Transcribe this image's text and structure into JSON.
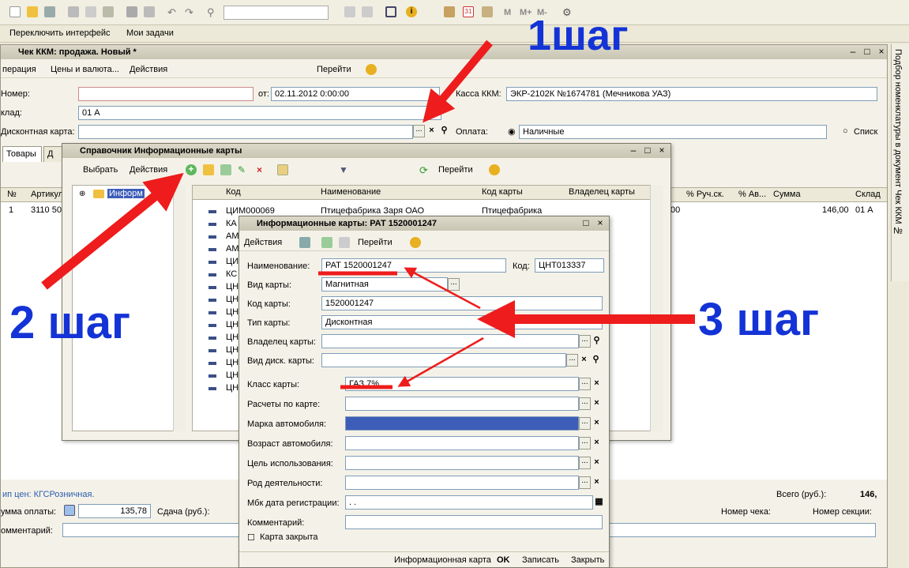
{
  "top": {
    "switch_iface": "Переключить интерфейс",
    "my_tasks": "Мои задачи",
    "letters_m": "M",
    "letters_mplus": "M+",
    "letters_mminus": "M-"
  },
  "main": {
    "title": "Чек ККМ: продажа. Новый *",
    "menu": {
      "operation": "перация",
      "prices": "Цены и валюта...",
      "actions": "Действия",
      "goto": "Перейти"
    },
    "fields": {
      "number_label": "Номер:",
      "date_label": "от:",
      "date_value": "02.11.2012  0:00:00",
      "kassa_label": "Касса ККМ:",
      "kassa_value": "ЭКР-2102К №1674781 (Мечникова УАЗ)",
      "warehouse_label": "клад:",
      "warehouse_value": "01 А",
      "card_label": "Дисконтная карта:",
      "payment_label": "Оплата:",
      "payment_value": "Наличные",
      "list_label": "Списк"
    },
    "tabs": {
      "goods": "Товары",
      "d": "Д"
    },
    "columns": {
      "num": "№",
      "article": "Артикул",
      "percent_manual": "% Руч.ск.",
      "percent_auto": "% Ав...",
      "sum": "Сумма",
      "warehouse": "Склад"
    },
    "row": {
      "num": "1",
      "article": "3110 50",
      "v1": "00",
      "sum": "146,00",
      "wh": "01 А"
    },
    "footer": {
      "price_type": "ип цен: КГСРозничная.",
      "total_label": "Всего (руб.):",
      "total_value": "146,",
      "pay_sum_label": "умма оплаты:",
      "pay_sum_value": "135,78",
      "change_label": "Сдача (руб.):",
      "check_no_label": "Номер чека:",
      "section_label": "Номер секции:",
      "comment_label": "омментарий:"
    }
  },
  "right_panel": {
    "text": "Подбор номенклатуры в документ Чек ККМ №"
  },
  "ref_window": {
    "title": "Справочник Информационные карты",
    "toolbar": {
      "select": "Выбрать",
      "actions": "Действия",
      "goto": "Перейти"
    },
    "tree_root": "Информ",
    "columns": {
      "code": "Код",
      "name": "Наименование",
      "card_code": "Код карты",
      "owner": "Владелец карты"
    },
    "first_row": {
      "code": "ЦИМ000069",
      "name": "Птицефабрика Заря ОАО",
      "card": "Птицефабрика"
    },
    "codes": [
      "КА",
      "АМ",
      "АМ",
      "ЦИ",
      "КС",
      "ЦН",
      "ЦН",
      "ЦН",
      "ЦН",
      "ЦН",
      "ЦН",
      "ЦН",
      "ЦН",
      "ЦН"
    ]
  },
  "info_window": {
    "title": "Информационные карты: РАТ 1520001247",
    "toolbar": {
      "actions": "Действия",
      "goto": "Перейти"
    },
    "fields": [
      {
        "label": "Наименование:",
        "value": "РАТ 1520001247"
      },
      {
        "label": "Вид карты:",
        "value": "Магнитная"
      },
      {
        "label": "Код карты:",
        "value": "1520001247"
      },
      {
        "label": "Тип карты:",
        "value": "Дисконтная"
      },
      {
        "label": "Владелец карты:",
        "value": ""
      },
      {
        "label": "Вид диск. карты:",
        "value": ""
      },
      {
        "label": "Класс карты:",
        "value": "ГАЗ 7%"
      },
      {
        "label": "Расчеты по карте:",
        "value": ""
      },
      {
        "label": "Марка автомобиля:",
        "value": ""
      },
      {
        "label": "Возраст автомобиля:",
        "value": ""
      },
      {
        "label": "Цель использования:",
        "value": ""
      },
      {
        "label": "Род деятельности:",
        "value": ""
      },
      {
        "label": "Мбк дата регистрации:",
        "value": ". ."
      },
      {
        "label": "Комментарий:",
        "value": ""
      }
    ],
    "code_label": "Код:",
    "code_value": "ЦНТ013337",
    "card_closed": "Карта закрыта",
    "footer": {
      "info_card": "Информационная карта",
      "ok": "OK",
      "save": "Записать",
      "close": "Закрыть"
    }
  },
  "annotations": {
    "step1": "1шаг",
    "step2": "2 шаг",
    "step3": "3 шаг"
  },
  "colors": {
    "arrow": "#ee1c1c",
    "step_text": "#1433d6",
    "selected": "#3d5db8"
  }
}
